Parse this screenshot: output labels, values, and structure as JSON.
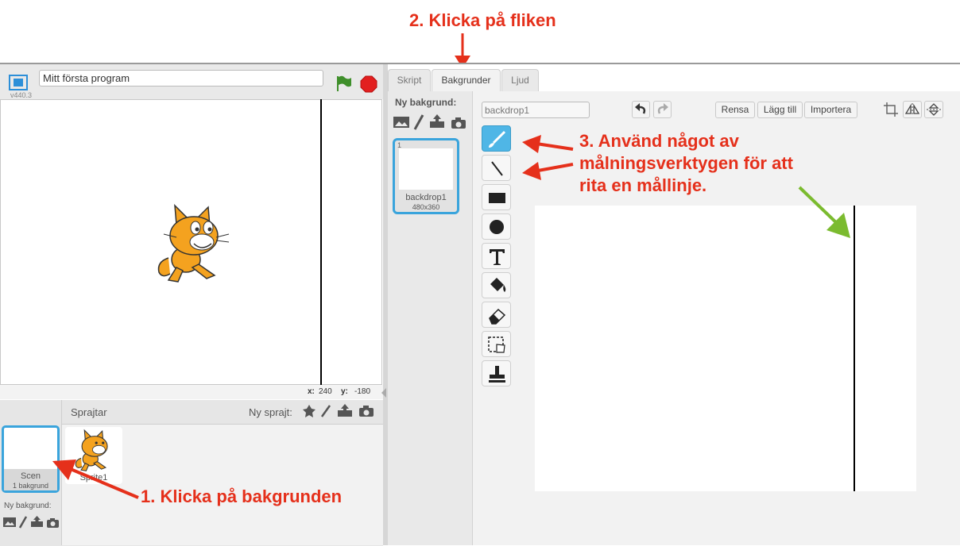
{
  "annotations": {
    "step1": "1. Klicka på bakgrunden",
    "step2": "2. Klicka på fliken",
    "step3_line1": "3. Använd något av",
    "step3_line2": "målningsverktygen för att",
    "step3_line3": "rita en mållinje."
  },
  "stage": {
    "project_name": "Mitt första program",
    "version": "v440.3",
    "coord_x_label": "x:",
    "coord_x_value": "240",
    "coord_y_label": "y:",
    "coord_y_value": "-180"
  },
  "sprites": {
    "header": "Sprajtar",
    "new_sprite_label": "Ny sprajt:",
    "scene_label": "Scen",
    "scene_count": "1 bakgrund",
    "new_backdrop_label": "Ny bakgrund:",
    "sprite1_name": "Sprite1"
  },
  "tabs": [
    {
      "label": "Skript"
    },
    {
      "label": "Bakgrunder"
    },
    {
      "label": "Ljud"
    }
  ],
  "backdrops": {
    "new_label": "Ny bakgrund:",
    "item_index": "1",
    "item_name": "backdrop1",
    "item_size": "480x360"
  },
  "paint_editor": {
    "name_value": "backdrop1",
    "clear_label": "Rensa",
    "add_label": "Lägg till",
    "import_label": "Importera"
  },
  "colors": {
    "accent": "#4fb6e6",
    "annotation": "#e5301b",
    "green_arrow": "#7bbb2f",
    "stop": "#e21f1f",
    "flag": "#3f8f2b"
  }
}
